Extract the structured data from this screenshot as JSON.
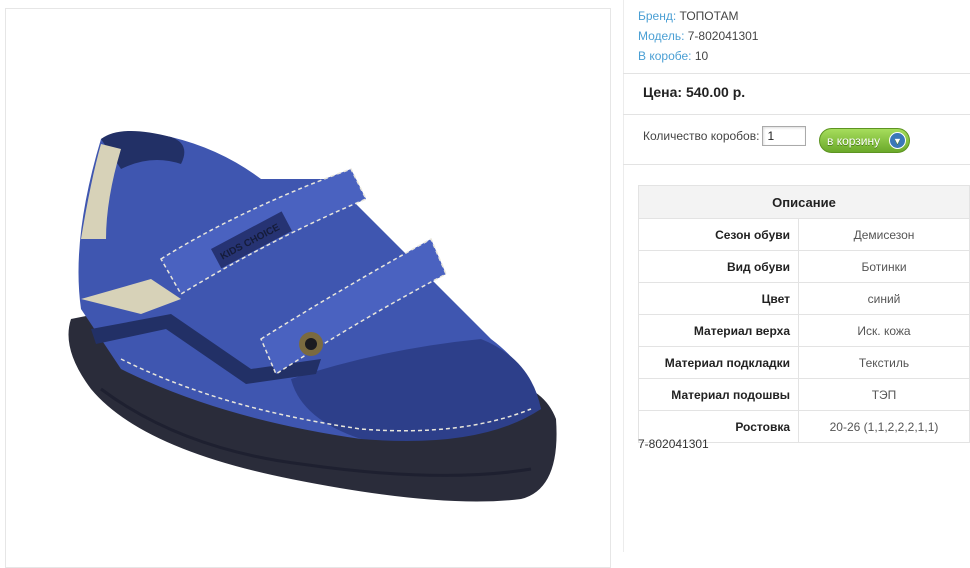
{
  "product": {
    "brand_label": "Бренд:",
    "brand_value": "ТОПОТАМ",
    "model_label": "Модель:",
    "model_value": "7-802041301",
    "box_label": "В коробе:",
    "box_value": "10",
    "price": "Цена: 540.00 р.",
    "quantity_label": "Количество коробов:",
    "quantity_value": "1",
    "cart_button": "в корзину",
    "sku": "7-802041301",
    "image_text_1": "KIDS CHOICE",
    "image_text_2": "CASUAL"
  },
  "specs": {
    "title": "Описание",
    "rows": [
      {
        "key": "Сезон обуви",
        "value": "Демисезон"
      },
      {
        "key": "Вид обуви",
        "value": "Ботинки"
      },
      {
        "key": "Цвет",
        "value": "синий"
      },
      {
        "key": "Материал верха",
        "value": "Иск. кожа"
      },
      {
        "key": "Материал подкладки",
        "value": "Текстиль"
      },
      {
        "key": "Материал подошвы",
        "value": "ТЭП"
      },
      {
        "key": "Ростовка",
        "value": "20-26 (1,1,2,2,2,1,1)"
      }
    ]
  },
  "colors": {
    "label_blue": "#4a9fd4",
    "cart_green": "#6ba92a",
    "shoe_blue": "#3f56b0",
    "sole_dark": "#2a2c3a"
  },
  "icons": [
    "cart-icon",
    "product-image"
  ]
}
